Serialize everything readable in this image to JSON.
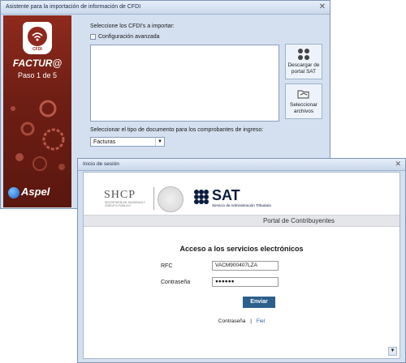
{
  "wizard": {
    "title": "Asistente para la importación de información de CFDI",
    "close_glyph": "✕",
    "brand": {
      "icon_label": "CFDI",
      "product_name": "FACTUR@",
      "step": "Paso 1 de 5",
      "aspel": "Aspel"
    },
    "select_label": "Seleccione los CFDI's a importar:",
    "advanced_config": "Configuración avanzada",
    "download_button": "Descargar de portal SAT",
    "select_files_button": "Seleccionar archivos",
    "doc_type_label": "Seleccionar el tipo de documento para los comprobantes de ingreso:",
    "doc_type_value": "Facturas"
  },
  "login": {
    "title": "Inicio de sesión",
    "close_glyph": "✕",
    "shcp": "SHCP",
    "shcp_sub": "SECRETARÍA DE HACIENDA Y CRÉDITO PÚBLICO",
    "sat": "SAT",
    "sat_sub": "Servicio de Administración Tributaria",
    "portal": "Portal de Contribuyentes",
    "heading": "Acceso a los servicios electrónicos",
    "rfc_label": "RFC",
    "rfc_value": "VACM900407LZA",
    "password_label": "Contraseña",
    "password_value": "●●●●●●",
    "submit": "Enviar",
    "link_password": "Contraseña",
    "separator": "|",
    "link_fiel": "Fiel"
  },
  "colors": {
    "brand": "#8e2a1d",
    "submit": "#2c5f8c",
    "window": "#d4e0f0"
  }
}
